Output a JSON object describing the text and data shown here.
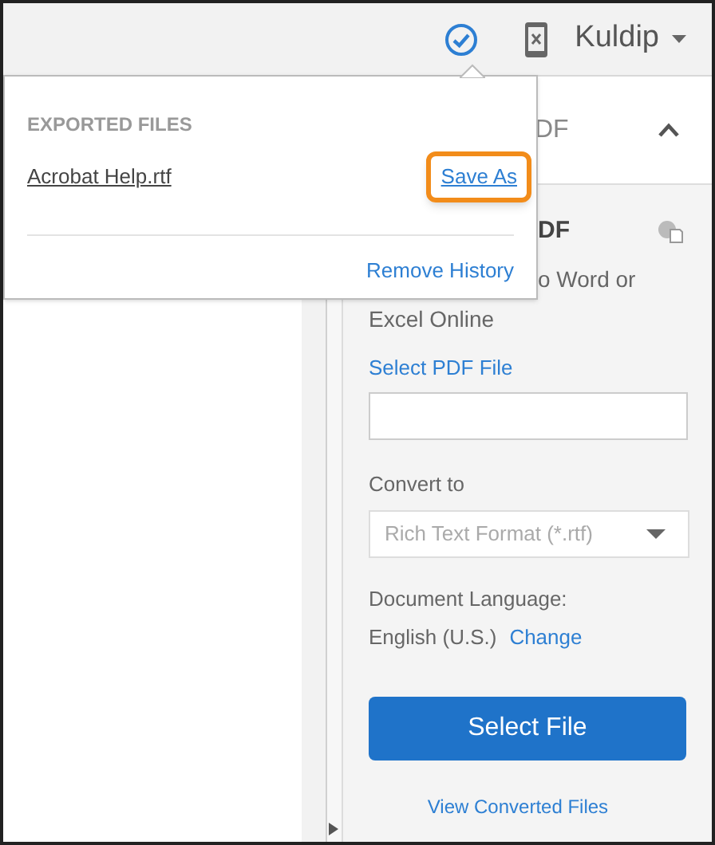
{
  "top_bar": {
    "user": "Kuldip"
  },
  "popup": {
    "heading": "EXPORTED FILES",
    "files": [
      {
        "name": "Acrobat Help.rtf",
        "action": "Save As",
        "highlighted": true
      }
    ],
    "footer_link": "Remove History"
  },
  "panel": {
    "header_text": "DF",
    "expanded": true,
    "title": "DF",
    "description_lines": [
      "o Word or",
      "Excel Online"
    ],
    "file_label": "Select PDF File",
    "convert_label": "Convert to",
    "convert_value": "Rich Text Format (*.rtf)",
    "language_label": "Document Language:",
    "language_value": "English (U.S.)",
    "language_link": "Change",
    "primary_button": "Select File",
    "bottom_link": "View Converted Files"
  }
}
